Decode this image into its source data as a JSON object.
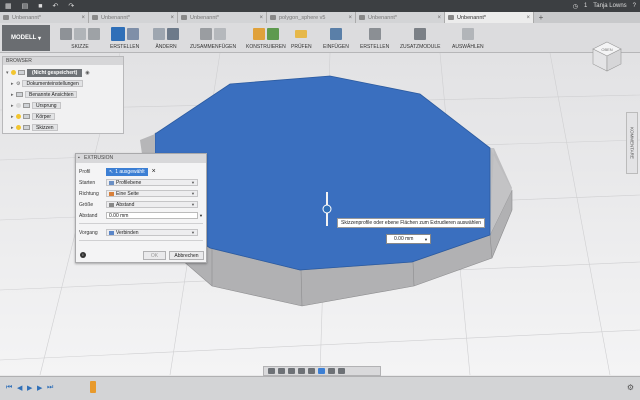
{
  "titlebar": {
    "user": "Tanja Lowns",
    "clock": "1"
  },
  "tabs": [
    {
      "label": "Unbenannt*"
    },
    {
      "label": "Unbenannt*"
    },
    {
      "label": "Unbenannt*"
    },
    {
      "label": "polygon_sphere v5"
    },
    {
      "label": "Unbenannt*"
    },
    {
      "label": "Unbenannt*",
      "active": true
    }
  ],
  "toolbar": {
    "workspace": "MODELL",
    "groups": [
      "SKIZZE",
      "ERSTELLEN",
      "ÄNDERN",
      "ZUSAMMENFÜGEN",
      "KONSTRUIEREN",
      "PRÜFEN",
      "EINFÜGEN",
      "ERSTELLEN",
      "ZUSATZMODULE",
      "AUSWÄHLEN"
    ]
  },
  "browser": {
    "title": "BROWSER",
    "root": "(Nicht gespeichert)",
    "items": [
      "Dokumenteinstellungen",
      "Benannte Ansichten",
      "Ursprung",
      "Körper",
      "Skizzen"
    ]
  },
  "extrusion": {
    "title": "EXTRUSION",
    "rows": {
      "profil": {
        "label": "Profil",
        "value": "1 ausgewählt"
      },
      "starten": {
        "label": "Starten",
        "value": "Profilebene"
      },
      "richtung": {
        "label": "Richtung",
        "value": "Eine Seite"
      },
      "groesse": {
        "label": "Größe",
        "value": "Abstand"
      },
      "abstand": {
        "label": "Abstand",
        "value": "0.00 mm"
      },
      "vorgang": {
        "label": "Vorgang",
        "value": "Verbinden"
      }
    },
    "ok_label": "OK",
    "cancel_label": "Abbrechen"
  },
  "viewport": {
    "tooltip": "Skizzenprofile oder ebene Flächen zum Extrudieren auswählen",
    "distance_value": "0.00 mm",
    "cube_label": "OBEN",
    "side_panel": "KOMMENTARE"
  },
  "colors": {
    "face": "#3a6fbf",
    "side": "#b9b9bb",
    "accent": "#3c7fd4"
  }
}
